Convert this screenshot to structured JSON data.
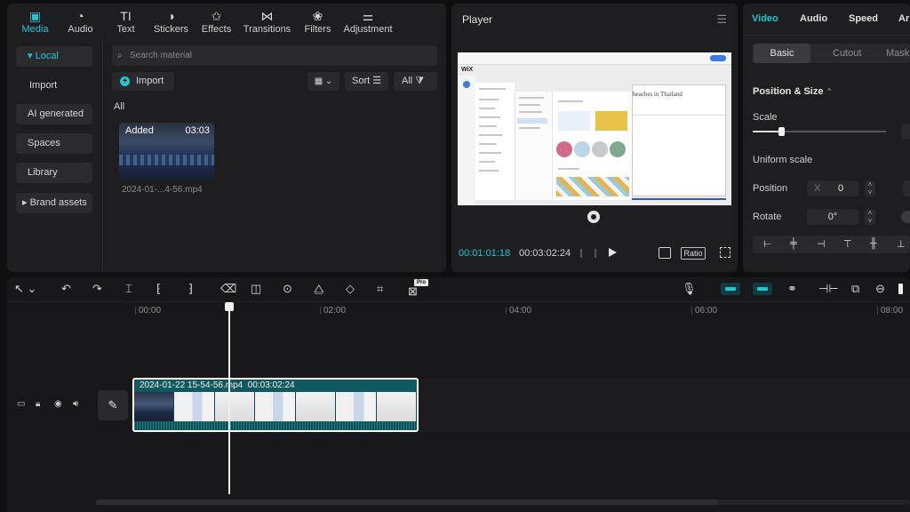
{
  "media": {
    "toolbar": [
      {
        "label": "Media",
        "icon": "media-icon",
        "glyph": "▣"
      },
      {
        "label": "Audio",
        "icon": "audio-icon",
        "glyph": "◔"
      },
      {
        "label": "Text",
        "icon": "text-icon",
        "glyph": "TI"
      },
      {
        "label": "Stickers",
        "icon": "stickers-icon",
        "glyph": "◑"
      },
      {
        "label": "Effects",
        "icon": "effects-icon",
        "glyph": "✩"
      },
      {
        "label": "Transitions",
        "icon": "transitions-icon",
        "glyph": "⋈"
      },
      {
        "label": "Filters",
        "icon": "filters-icon",
        "glyph": "❀"
      },
      {
        "label": "Adjustment",
        "icon": "adjustment-icon",
        "glyph": "⚌"
      }
    ],
    "sidebar": [
      "Local",
      "Import",
      "AI generated",
      "Spaces",
      "Library",
      "Brand assets"
    ],
    "search_placeholder": "Search material",
    "import_label": "Import",
    "sort_label": "Sort",
    "filter_label": "All",
    "section_label": "All",
    "clip": {
      "badge": "Added",
      "duration": "03:03",
      "filename": "2024-01-...4-56.mp4"
    }
  },
  "player": {
    "title": "Player",
    "preview_logo": "WiX",
    "preview_heading": "beaches in Thailand",
    "current_time": "00:01:01:18",
    "total_time": "00:03:02:24",
    "ratio_label": "Ratio"
  },
  "props": {
    "tabs": [
      "Video",
      "Audio",
      "Speed",
      "Ar"
    ],
    "subtabs": [
      "Basic",
      "Cutout",
      "Mask"
    ],
    "section": "Position & Size",
    "scale_label": "Scale",
    "scale_fraction": 0.21,
    "uniform_label": "Uniform scale",
    "position_label": "Position",
    "position_axis": "X",
    "position_x": "0",
    "rotate_label": "Rotate",
    "rotate_value": "0°"
  },
  "timeline": {
    "ruler": [
      "00:00",
      "02:00",
      "04:00",
      "06:00",
      "08:00"
    ],
    "clip_name": "2024-01-22 15-54-56.mp4",
    "clip_duration": "00:03:02:24",
    "pro_badge": "Pro"
  },
  "colors": {
    "accent": "#21c6d4",
    "clip": "#0e5a60"
  }
}
